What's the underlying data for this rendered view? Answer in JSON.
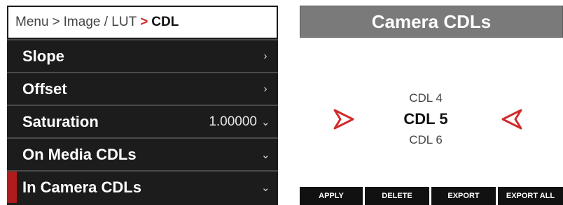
{
  "menu": {
    "breadcrumb": {
      "root": "Menu",
      "sep1": ">",
      "section": "Image / LUT",
      "sep2": ">",
      "current": "CDL"
    },
    "items": [
      {
        "label": "Slope",
        "value": "",
        "icon": "chevron-right-icon"
      },
      {
        "label": "Offset",
        "value": "",
        "icon": "chevron-right-icon"
      },
      {
        "label": "Saturation",
        "value": "1.00000",
        "icon": "chevron-down-icon"
      },
      {
        "label": "On Media CDLs",
        "value": "",
        "icon": "chevron-down-icon"
      },
      {
        "label": "In Camera CDLs",
        "value": "",
        "icon": "chevron-down-icon",
        "selected": true
      }
    ],
    "accent_color": "#b01c1c"
  },
  "camera_cdls": {
    "title": "Camera CDLs",
    "list": [
      "CDL 4",
      "CDL 5",
      "CDL 6"
    ],
    "selected": "CDL 5",
    "arrow_color": "#d22a2a",
    "softkeys": [
      "APPLY",
      "DELETE",
      "EXPORT",
      "EXPORT ALL"
    ]
  }
}
